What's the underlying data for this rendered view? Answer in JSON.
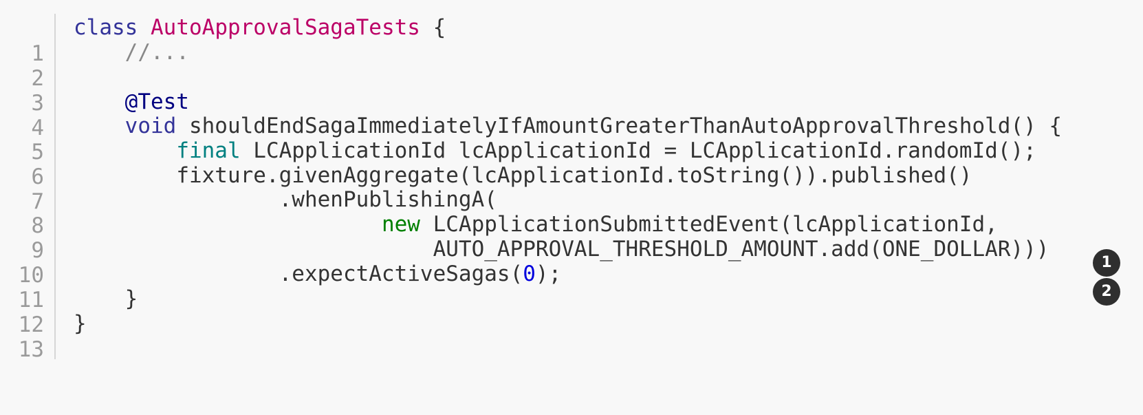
{
  "code": {
    "line_numbers": [
      "1",
      "2",
      "3",
      "4",
      "5",
      "6",
      "7",
      "8",
      "9",
      "10",
      "11",
      "12",
      "13"
    ],
    "line1": {
      "keyword": "class",
      "class_name": "AutoApprovalSagaTests",
      "rest": " {"
    },
    "line2": {
      "comment": "//..."
    },
    "line4": {
      "annotation": "@Test"
    },
    "line5": {
      "keyword": "void",
      "rest": " shouldEndSagaImmediatelyIfAmountGreaterThanAutoApprovalThreshold() {"
    },
    "line6": {
      "keyword": "final",
      "rest": " LCApplicationId lcApplicationId = LCApplicationId.randomId();"
    },
    "line7": {
      "text": "fixture.givenAggregate(lcApplicationId.toString()).published()"
    },
    "line8": {
      "text": ".whenPublishingA("
    },
    "line9": {
      "keyword": "new",
      "rest": " LCApplicationSubmittedEvent(lcApplicationId,"
    },
    "line10": {
      "text": "AUTO_APPROVAL_THRESHOLD_AMOUNT.add(ONE_DOLLAR)))"
    },
    "line11": {
      "prefix": ".expectActiveSagas(",
      "number": "0",
      "suffix": ");"
    },
    "line12": {
      "text": "}"
    },
    "line13": {
      "text": "}"
    }
  },
  "callouts": [
    "1",
    "2"
  ]
}
